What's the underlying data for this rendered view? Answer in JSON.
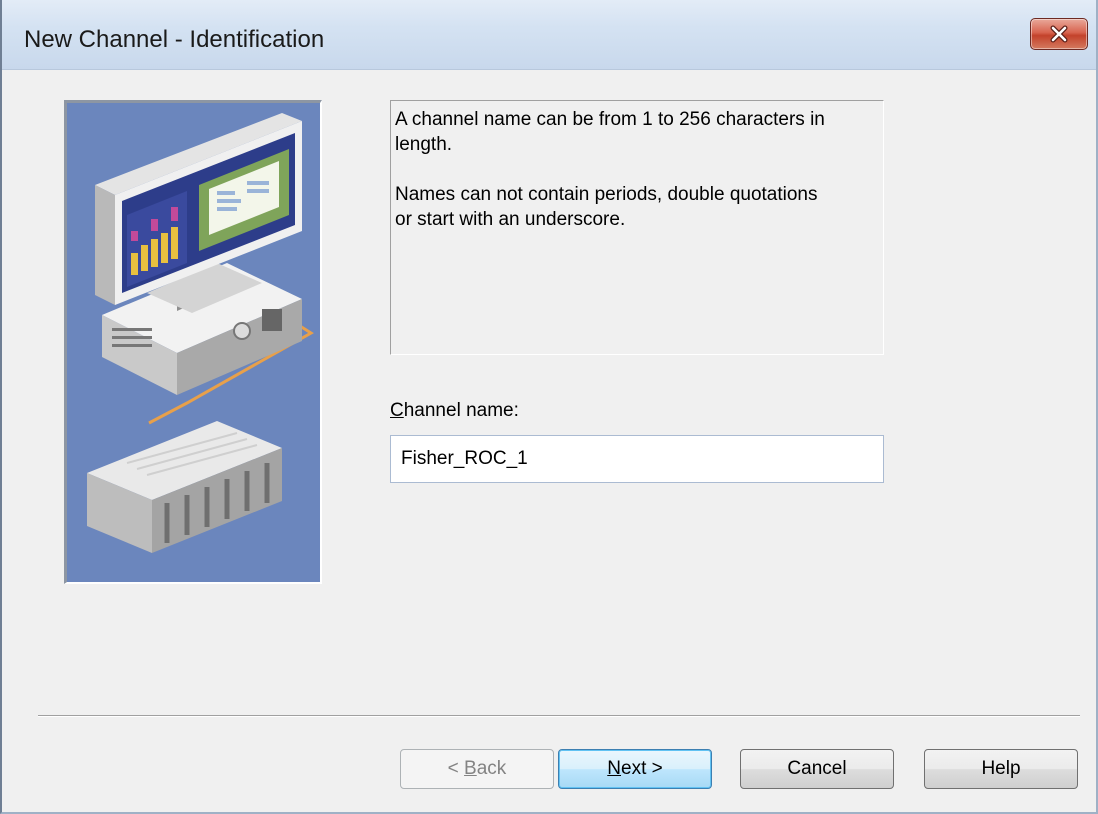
{
  "window": {
    "title": "New Channel - Identification",
    "close_icon": "close-icon"
  },
  "illustration": {
    "icon": "computer-to-plc-network-illustration",
    "colors": {
      "background": "#6b86bd",
      "cable": "#e8a04a"
    }
  },
  "info": {
    "line1": "A channel name can be from 1 to 256 characters in length.",
    "line2": "Names can not contain periods, double quotations or start with an underscore."
  },
  "channel_name": {
    "label_mnemonic": "C",
    "label_rest": "hannel name:",
    "value": "Fisher_ROC_1"
  },
  "buttons": {
    "back": {
      "prefix": "< ",
      "mnemonic": "B",
      "rest": "ack",
      "enabled": false
    },
    "next": {
      "mnemonic": "N",
      "rest": "ext >",
      "default": true
    },
    "cancel": {
      "label": "Cancel"
    },
    "help": {
      "label": "Help"
    }
  }
}
